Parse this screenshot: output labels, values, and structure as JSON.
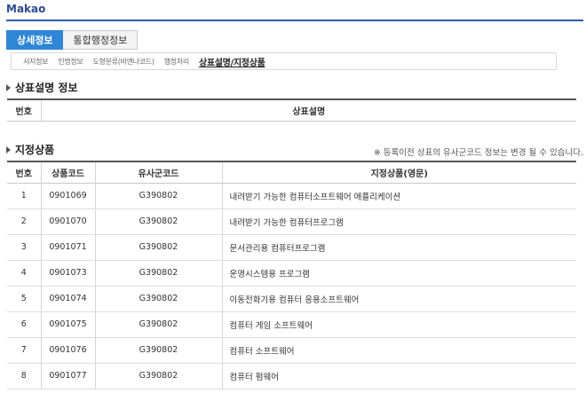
{
  "app": {
    "title": "Makao"
  },
  "tabs": [
    {
      "label": "상세정보",
      "active": true
    },
    {
      "label": "통합행정정보",
      "active": false
    }
  ],
  "subnav": [
    {
      "label": "서지정보",
      "current": false
    },
    {
      "label": "인명정보",
      "current": false
    },
    {
      "label": "도형분류(비엔나코드)",
      "current": false
    },
    {
      "label": "행정처리",
      "current": false
    },
    {
      "label": "상표설명/지정상품",
      "current": true
    }
  ],
  "description_section": {
    "title": "상표설명 정보",
    "headers": [
      "번호",
      "상표설명"
    ]
  },
  "goods_section": {
    "title": "지정상품",
    "note": "※ 등록이전 상표의 유사군코드 정보는 변경 될 수 있습니다.",
    "headers": [
      "번호",
      "상품코드",
      "유사군코드",
      "지정상품(영문)"
    ],
    "rows": [
      {
        "no": "1",
        "code": "0901069",
        "similar": "G390802",
        "goods": "내려받기 가능한 컴퓨터소프트웨어 애플리케이션"
      },
      {
        "no": "2",
        "code": "0901070",
        "similar": "G390802",
        "goods": "내려받기 가능한 컴퓨터프로그램"
      },
      {
        "no": "3",
        "code": "0901071",
        "similar": "G390802",
        "goods": "문서관리용 컴퓨터프로그램"
      },
      {
        "no": "4",
        "code": "0901073",
        "similar": "G390802",
        "goods": "운영시스템용 프로그램"
      },
      {
        "no": "5",
        "code": "0901074",
        "similar": "G390802",
        "goods": "이동전화기용 컴퓨터 응용소프트웨어"
      },
      {
        "no": "6",
        "code": "0901075",
        "similar": "G390802",
        "goods": "컴퓨터 게임 소프트웨어"
      },
      {
        "no": "7",
        "code": "0901076",
        "similar": "G390802",
        "goods": "컴퓨터 소프트웨어"
      },
      {
        "no": "8",
        "code": "0901077",
        "similar": "G390802",
        "goods": "컴퓨터 펌웨어"
      }
    ]
  },
  "colors": {
    "accent": "#2f86d6",
    "title_rule": "#2e5aa8"
  }
}
